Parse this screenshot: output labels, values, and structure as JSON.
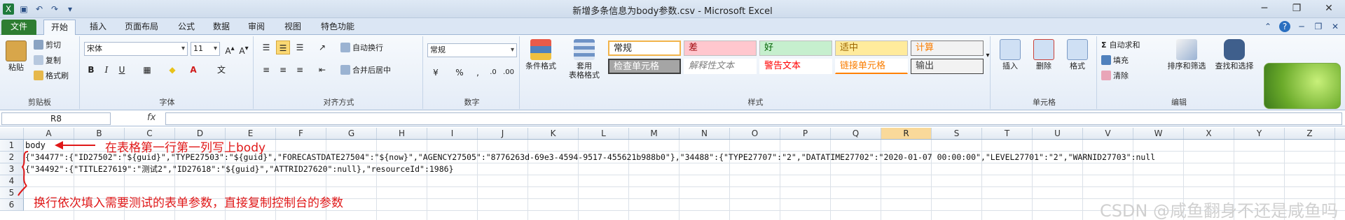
{
  "window": {
    "title": "新增多条信息为body参数.csv - Microsoft Excel",
    "controls": [
      "minimize",
      "restore",
      "close"
    ]
  },
  "ribbon_tabs": [
    "文件",
    "开始",
    "插入",
    "页面布局",
    "公式",
    "数据",
    "审阅",
    "视图",
    "特色功能"
  ],
  "clipboard": {
    "paste": "粘贴",
    "cut": "剪切",
    "copy": "复制",
    "painter": "格式刷",
    "label": "剪贴板"
  },
  "font": {
    "name": "宋体",
    "size": "11",
    "label": "字体"
  },
  "alignment": {
    "wrap": "自动换行",
    "merge": "合并后居中",
    "label": "对齐方式"
  },
  "number": {
    "format": "常规",
    "label": "数字"
  },
  "styles_group": {
    "conditional": "条件格式",
    "table": "套用",
    "table2": "表格格式",
    "label": "样式",
    "cells": [
      "常规",
      "差",
      "好",
      "适中",
      "计算",
      "检查单元格",
      "解释性文本",
      "警告文本",
      "链接单元格",
      "输出"
    ]
  },
  "cells_group": {
    "insert": "插入",
    "delete": "删除",
    "format": "格式",
    "label": "单元格"
  },
  "editing": {
    "autosum": "自动求和",
    "fill": "填充",
    "clear": "清除",
    "sort": "排序和筛选",
    "find": "查找和选择",
    "label": "编辑"
  },
  "formula_bar": {
    "namebox": "R8",
    "fx": "fx",
    "value": ""
  },
  "columns": [
    "A",
    "B",
    "C",
    "D",
    "E",
    "F",
    "G",
    "H",
    "I",
    "J",
    "K",
    "L",
    "M",
    "N",
    "O",
    "P",
    "Q",
    "R",
    "S",
    "T",
    "U",
    "V",
    "W",
    "X",
    "Y",
    "Z"
  ],
  "selected_column": "R",
  "rows": [
    "1",
    "2",
    "3",
    "4",
    "5",
    "6"
  ],
  "cells": {
    "a1": "body",
    "a2": "{\"34477\":{\"ID27502\":\"${guid}\",\"TYPE27503\":\"${guid}\",\"FORECASTDATE27504\":\"${now}\",\"AGENCY27505\":\"8776263d-69e3-4594-9517-455621b988b0\"},\"34488\":{\"TYPE27707\":\"2\",\"DATATIME27702\":\"2020-01-07 00:00:00\",\"LEVEL27701\":\"2\",\"WARNID27703\":null",
    "a3": "{\"34492\":{\"TITLE27619\":\"测试2\",\"ID27618\":\"${guid}\",\"ATTRID27620\":null},\"resourceId\":1986}"
  },
  "annotations": {
    "first": "在表格第一行第一列写上body",
    "second": "换行依次填入需要测试的表单参数，直接复制控制台的参数"
  },
  "watermark": "CSDN @咸鱼翻身不还是咸鱼吗",
  "colors": {
    "annotation": "#e01818",
    "file_tab": "#2e7d32",
    "selected_header": "#f9d99a"
  }
}
